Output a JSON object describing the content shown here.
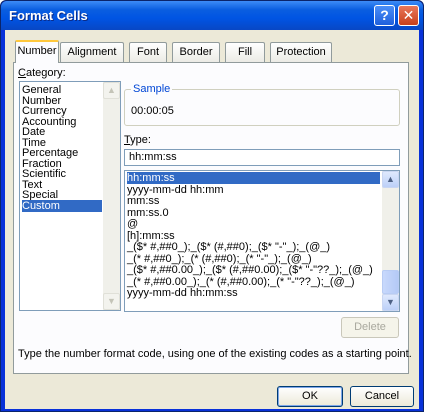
{
  "window": {
    "title": "Format Cells",
    "help_glyph": "?",
    "close_glyph": "✕"
  },
  "tabs": [
    {
      "label": "Number"
    },
    {
      "label": "Alignment"
    },
    {
      "label": "Font"
    },
    {
      "label": "Border"
    },
    {
      "label": "Fill"
    },
    {
      "label": "Protection"
    }
  ],
  "category": {
    "label_first": "C",
    "label_rest": "ategory:",
    "items": [
      "General",
      "Number",
      "Currency",
      "Accounting",
      "Date",
      "Time",
      "Percentage",
      "Fraction",
      "Scientific",
      "Text",
      "Special",
      "Custom"
    ],
    "selected": "Custom"
  },
  "sample": {
    "legend": "Sample",
    "value": "00:00:05"
  },
  "type": {
    "label_first": "T",
    "label_rest": "ype:",
    "value": "hh:mm:ss",
    "list": [
      "hh:mm:ss",
      "yyyy-mm-dd hh:mm",
      "mm:ss",
      "mm:ss.0",
      "@",
      "[h]:mm:ss",
      "_($* #,##0_);_($* (#,##0);_($* \"-\"_);_(@_)",
      "_(* #,##0_);_(* (#,##0);_(* \"-\"_);_(@_)",
      "_($* #,##0.00_);_($* (#,##0.00);_($* \"-\"??_);_(@_)",
      "_(* #,##0.00_);_(* (#,##0.00);_(* \"-\"??_);_(@_)",
      "yyyy-mm-dd hh:mm:ss"
    ],
    "selected": "hh:mm:ss"
  },
  "delete_label": "Delete",
  "hint": "Type the number format code, using one of the existing codes as a starting point.",
  "ok_label": "OK",
  "cancel_label": "Cancel",
  "scroll_up_glyph": "▲",
  "scroll_down_glyph": "▼"
}
